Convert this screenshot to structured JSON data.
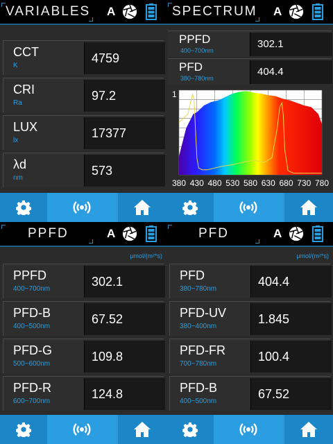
{
  "panels": {
    "variables": {
      "title": "VARIABLES",
      "rows": [
        {
          "name": "CCT",
          "sub": "K",
          "value": "4759"
        },
        {
          "name": "CRI",
          "sub": "Ra",
          "value": "97.2"
        },
        {
          "name": "LUX",
          "sub": "lx",
          "value": "17377"
        },
        {
          "name": "λd",
          "sub": "nm",
          "value": "573"
        }
      ]
    },
    "spectrum": {
      "title": "SPECTRUM",
      "rows": [
        {
          "name": "PPFD",
          "sub": "400~700nm",
          "value": "302.1"
        },
        {
          "name": "PFD",
          "sub": "380~780nm",
          "value": "404.4"
        }
      ]
    },
    "ppfd": {
      "title": "PPFD",
      "unit": "μmol/(m²*s)",
      "rows": [
        {
          "name": "PPFD",
          "sub": "400~700nm",
          "value": "302.1"
        },
        {
          "name": "PFD-B",
          "sub": "400~500nm",
          "value": "67.52"
        },
        {
          "name": "PFD-G",
          "sub": "500~600nm",
          "value": "109.8"
        },
        {
          "name": "PFD-R",
          "sub": "600~700nm",
          "value": "124.8"
        }
      ]
    },
    "pfd": {
      "title": "PFD",
      "unit": "μmol/(m²*s)",
      "rows": [
        {
          "name": "PFD",
          "sub": "380~780nm",
          "value": "404.4"
        },
        {
          "name": "PFD-UV",
          "sub": "380~400nm",
          "value": "1.845"
        },
        {
          "name": "PFD-FR",
          "sub": "700~780nm",
          "value": "100.4"
        },
        {
          "name": "PFD-B",
          "sub": "400~500nm",
          "value": "67.52"
        }
      ]
    }
  },
  "header_icons": {
    "auto_label": "A",
    "aperture": "aperture-icon",
    "battery": "battery-icon"
  },
  "footer_icons": [
    "gear-icon",
    "signal-icon",
    "home-icon"
  ],
  "colors": {
    "accent": "#2a9ee0",
    "footer": "#1c87c8",
    "background": "#2b2b2b"
  },
  "chart_data": {
    "type": "line",
    "title": "",
    "xlabel": "",
    "ylabel": "",
    "x_ticks": [
      "380",
      "430",
      "480",
      "530",
      "580",
      "630",
      "680",
      "730",
      "780"
    ],
    "y_ticks": [
      "1"
    ],
    "xlim": [
      380,
      780
    ],
    "ylim": [
      0,
      1
    ],
    "grid": true,
    "series": [
      {
        "x": [
          380,
          400,
          420,
          430,
          450,
          470,
          490,
          510,
          530,
          550,
          570,
          590,
          610,
          630,
          650,
          670,
          690,
          710,
          730,
          750,
          770,
          780
        ],
        "y": [
          0.22,
          0.55,
          0.72,
          0.74,
          0.82,
          0.86,
          0.88,
          0.92,
          0.96,
          0.98,
          0.99,
          0.97,
          0.96,
          0.94,
          0.93,
          0.9,
          0.88,
          0.85,
          0.82,
          0.8,
          0.72,
          0.6
        ]
      },
      {
        "x": [
          380,
          395,
          405,
          412,
          418,
          422,
          426,
          430,
          435,
          445,
          460,
          480,
          500,
          530,
          560,
          590,
          620,
          640,
          655,
          662,
          668,
          672,
          676,
          685,
          700,
          740,
          780
        ],
        "y": [
          0.62,
          0.68,
          0.72,
          0.85,
          0.95,
          0.9,
          0.55,
          0.2,
          0.08,
          0.06,
          0.06,
          0.08,
          0.1,
          0.12,
          0.15,
          0.17,
          0.15,
          0.2,
          0.55,
          0.8,
          0.85,
          0.7,
          0.3,
          0.05,
          0.02,
          0.02,
          0.02
        ]
      }
    ]
  }
}
